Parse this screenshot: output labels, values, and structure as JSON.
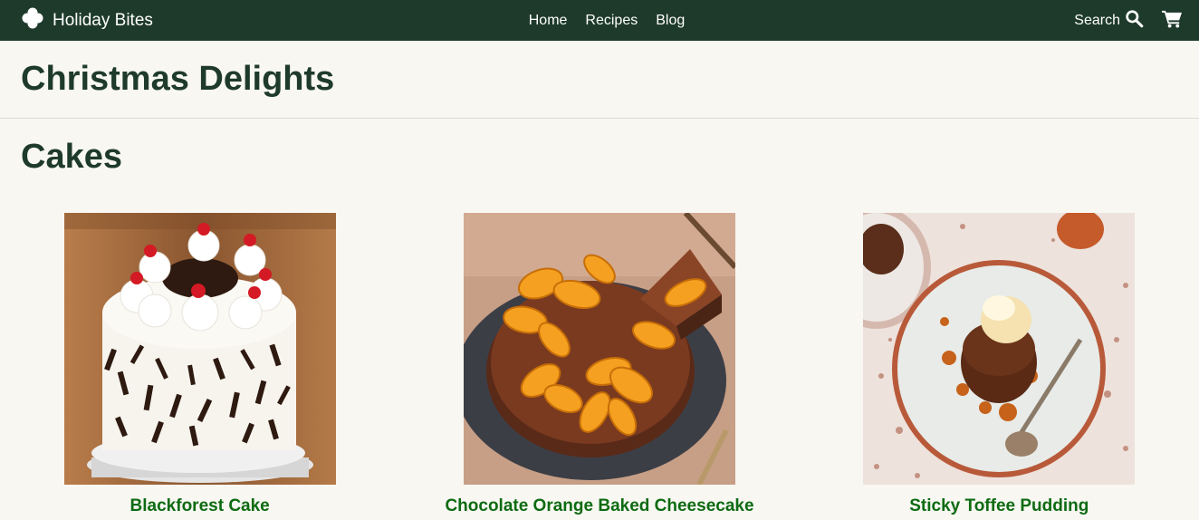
{
  "nav": {
    "brand": "Holiday Bites",
    "links": [
      "Home",
      "Recipes",
      "Blog"
    ],
    "search_label": "Search"
  },
  "hero": {
    "title": "Christmas Delights"
  },
  "section": {
    "title": "Cakes"
  },
  "cards": [
    {
      "title": "Blackforest Cake"
    },
    {
      "title": "Chocolate Orange Baked Cheesecake"
    },
    {
      "title": "Sticky Toffee Pudding"
    }
  ],
  "colors": {
    "nav_bg": "#1e3a2b",
    "page_bg": "#f8f7f1",
    "heading": "#1e3a2b",
    "card_title": "#0d6b12"
  },
  "icons": [
    "clover-icon",
    "search-icon",
    "cart-icon"
  ]
}
